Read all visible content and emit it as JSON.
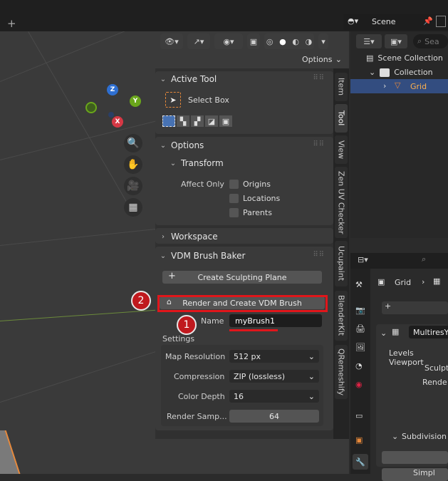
{
  "scene": {
    "label": "Scene"
  },
  "header": {
    "options_label": "Options"
  },
  "npanel": {
    "active_tool": {
      "title": "Active Tool",
      "tool_name": "Select Box"
    },
    "options": {
      "title": "Options",
      "transform_title": "Transform",
      "affect_only_label": "Affect Only",
      "checkboxes": [
        "Origins",
        "Locations",
        "Parents"
      ]
    },
    "workspace": {
      "title": "Workspace"
    },
    "vdm": {
      "title": "VDM Brush Baker",
      "create_plane_label": "Create Sculpting Plane",
      "render_create_label": "Render and Create VDM Brush",
      "name_label": "Name",
      "name_value": "myBrush1",
      "settings_label": "Settings",
      "map_resolution_label": "Map Resolution",
      "map_resolution_value": "512 px",
      "compression_label": "Compression",
      "compression_value": "ZIP (lossless)",
      "color_depth_label": "Color Depth",
      "color_depth_value": "16",
      "render_samples_label": "Render Samp...",
      "render_samples_value": "64"
    }
  },
  "vtabs": [
    "Item",
    "Tool",
    "View",
    "Zen UV Checker",
    "Ucupaint",
    "BlenderKit",
    "QRemeshify"
  ],
  "outliner": {
    "search_placeholder": "Sea",
    "items": [
      {
        "label": "Scene Collection"
      },
      {
        "label": "Collection"
      },
      {
        "label": "Grid"
      }
    ]
  },
  "properties": {
    "object_name": "Grid",
    "modifier_name": "MultiresY",
    "rows": [
      "Levels Viewport",
      "Sculpt",
      "Rende"
    ],
    "subdivision_label": "Subdivision",
    "bottom_label": "Simpl"
  },
  "annotations": {
    "badge1": "1",
    "badge2": "2"
  },
  "gizmo": {
    "x": "X",
    "y": "Y",
    "z": "Z"
  },
  "colors": {
    "highlight_red": "#e0161b",
    "grid_orange": "#e8893a",
    "selected_row": "#334d80"
  }
}
